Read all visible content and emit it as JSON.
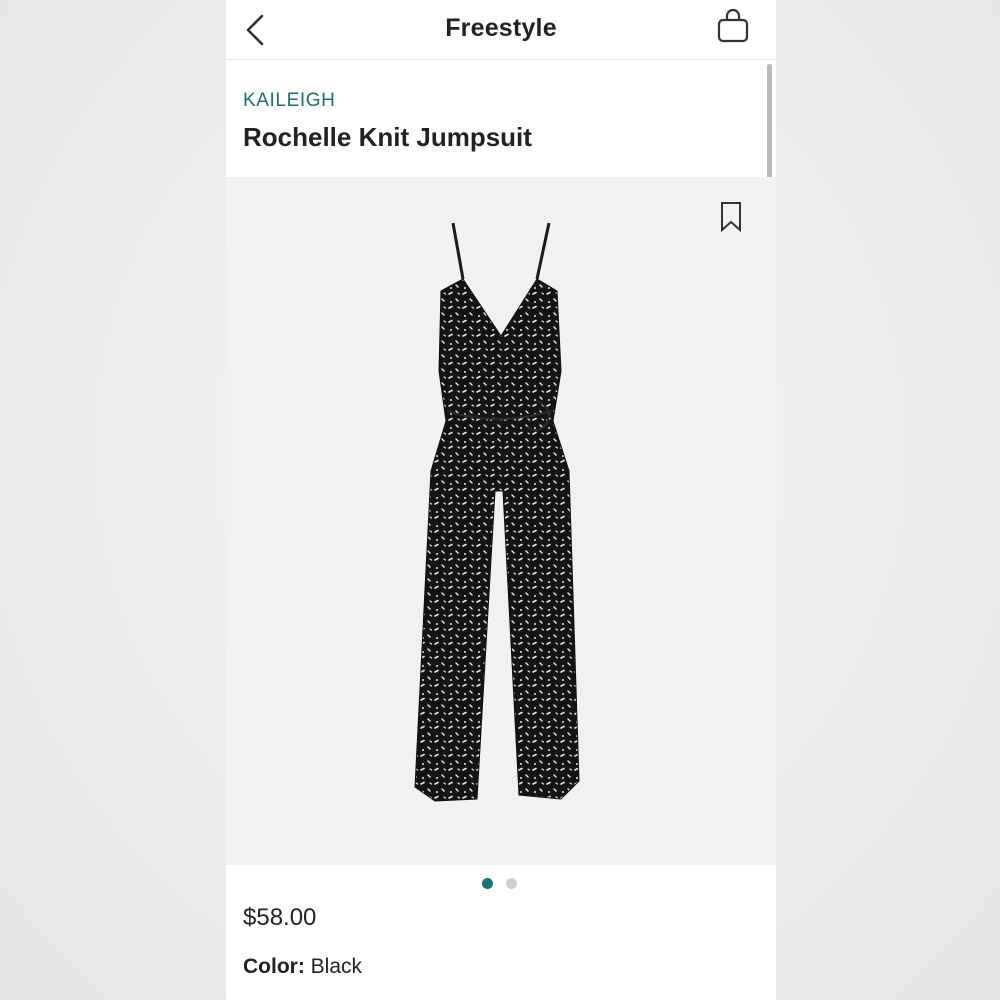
{
  "header": {
    "title": "Freestyle",
    "back_icon": "chevron-left-icon",
    "bag_icon": "shopping-bag-icon"
  },
  "product": {
    "brand": "KAILEIGH",
    "name": "Rochelle Knit Jumpsuit",
    "price": "$58.00",
    "color_label": "Color:",
    "color_value": "Black",
    "bookmark_icon": "bookmark-icon",
    "image_index": 1,
    "image_count": 2
  },
  "colors": {
    "brand_accent": "#1f6e6c",
    "active_dot": "#17767a",
    "inactive_dot": "#cfcfcf",
    "image_background": "#f1f1f2"
  }
}
